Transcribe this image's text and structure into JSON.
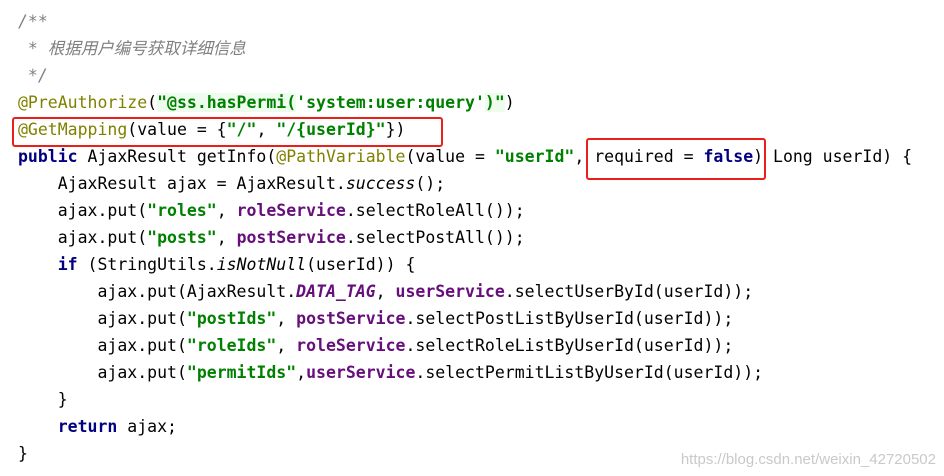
{
  "lines": {
    "l1": [
      "/**"
    ],
    "l2": [
      " * 根据用户编号获取详细信息"
    ],
    "l3": [
      " */"
    ],
    "l4": [
      "@PreAuthorize",
      "(",
      "\"@ss.hasPermi(",
      "'system:user:query'",
      ")\"",
      ")"
    ],
    "l5": [
      "@GetMapping",
      "(value = {",
      "\"/\"",
      ", ",
      "\"/{userId}\"",
      "})"
    ],
    "l6": [
      "public",
      " AjaxResult getInfo(",
      "@PathVariable",
      "(value = ",
      "\"userId\"",
      ", required = ",
      "false",
      ") Long userId) {"
    ],
    "l7": [
      "    AjaxResult ajax = AjaxResult.",
      "success",
      "();"
    ],
    "l8": [
      "    ajax.put(",
      "\"roles\"",
      ", ",
      "roleService",
      ".selectRoleAll());"
    ],
    "l9": [
      "    ajax.put(",
      "\"posts\"",
      ", ",
      "postService",
      ".selectPostAll());"
    ],
    "l10": [
      "    ",
      "if",
      " (StringUtils.",
      "isNotNull",
      "(userId)) {"
    ],
    "l11": [
      "        ajax.put(AjaxResult.",
      "DATA_TAG",
      ", ",
      "userService",
      ".selectUserById(userId));"
    ],
    "l12": [
      "        ajax.put(",
      "\"postIds\"",
      ", ",
      "postService",
      ".selectPostListByUserId(userId));"
    ],
    "l13": [
      "        ajax.put(",
      "\"roleIds\"",
      ", ",
      "roleService",
      ".selectRoleListByUserId(userId));"
    ],
    "l14": [
      "        ajax.put(",
      "\"permitIds\"",
      ",",
      "userService",
      ".selectPermitListByUserId(userId));"
    ],
    "l15": [
      "    }"
    ],
    "l16": [
      "    ",
      "return",
      " ajax;"
    ],
    "l17": [
      "}"
    ]
  },
  "watermark": "https://blog.csdn.net/weixin_42720502",
  "colors": {
    "keyword": "#000080",
    "string": "#008000",
    "annotation": "#808000",
    "comment": "#808080",
    "field": "#660e7a",
    "highlight_box": "#e8201a"
  }
}
